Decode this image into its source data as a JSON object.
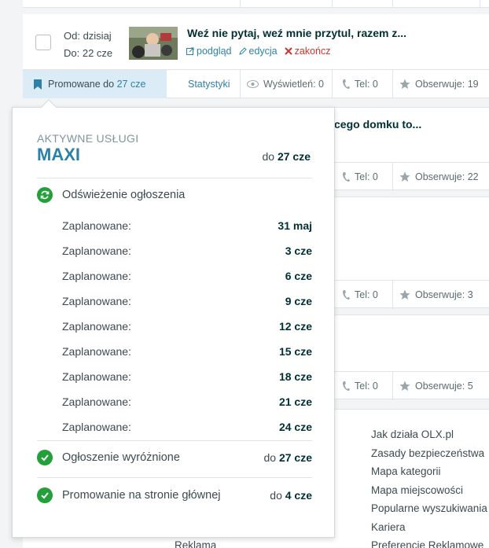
{
  "ad": {
    "date_from": "Od: dzisiaj",
    "date_to": "Do: 22 cze",
    "title": "Weź nie pytaj, weź mnie przytul, razem z...",
    "links": {
      "preview": "podgląd",
      "edit": "edycja",
      "end": "zakończ"
    }
  },
  "stats": {
    "promo_prefix": "Promowane do",
    "promo_date": "27 cze",
    "stats_link": "Statystyki",
    "views": "Wyświetleń: 0",
    "phone": "Tel: 0",
    "watch": "Obserwuje: 19"
  },
  "bg_rows": [
    {
      "title": "cego domku to...",
      "phone": "Tel: 0",
      "watch": "Obserwuje: 22"
    },
    {
      "phone": "Tel: 0",
      "watch": "Obserwuje: 3"
    },
    {
      "phone": "Tel: 0",
      "watch": "Obserwuje: 5"
    }
  ],
  "footer": {
    "links": [
      "Jak działa OLX.pl",
      "Zasady bezpieczeństwa",
      "Mapa kategorii",
      "Mapa miejscowości",
      "Popularne wyszukiwania",
      "Kariera",
      "Preferencje Reklamowe"
    ],
    "left": "Reklama"
  },
  "popup": {
    "subtitle": "AKTYWNE USŁUGI",
    "package": "MAXI",
    "until_prefix": "do",
    "until_date": "27 cze",
    "refresh_title": "Odświeżenie ogłoszenia",
    "scheduled_label": "Zaplanowane:",
    "scheduled": [
      "31 maj",
      "3 cze",
      "6 cze",
      "9 cze",
      "12 cze",
      "15 cze",
      "18 cze",
      "21 cze",
      "24 cze"
    ],
    "services": [
      {
        "name": "Ogłoszenie wyróżnione",
        "prefix": "do",
        "date": "27 cze"
      },
      {
        "name": "Promowanie na stronie głównej",
        "prefix": "do",
        "date": "4 cze"
      }
    ]
  },
  "colors": {
    "accent": "#2d81a6",
    "success": "#23a03a",
    "danger": "#d4302f",
    "promo_bg": "#dbecf7"
  }
}
